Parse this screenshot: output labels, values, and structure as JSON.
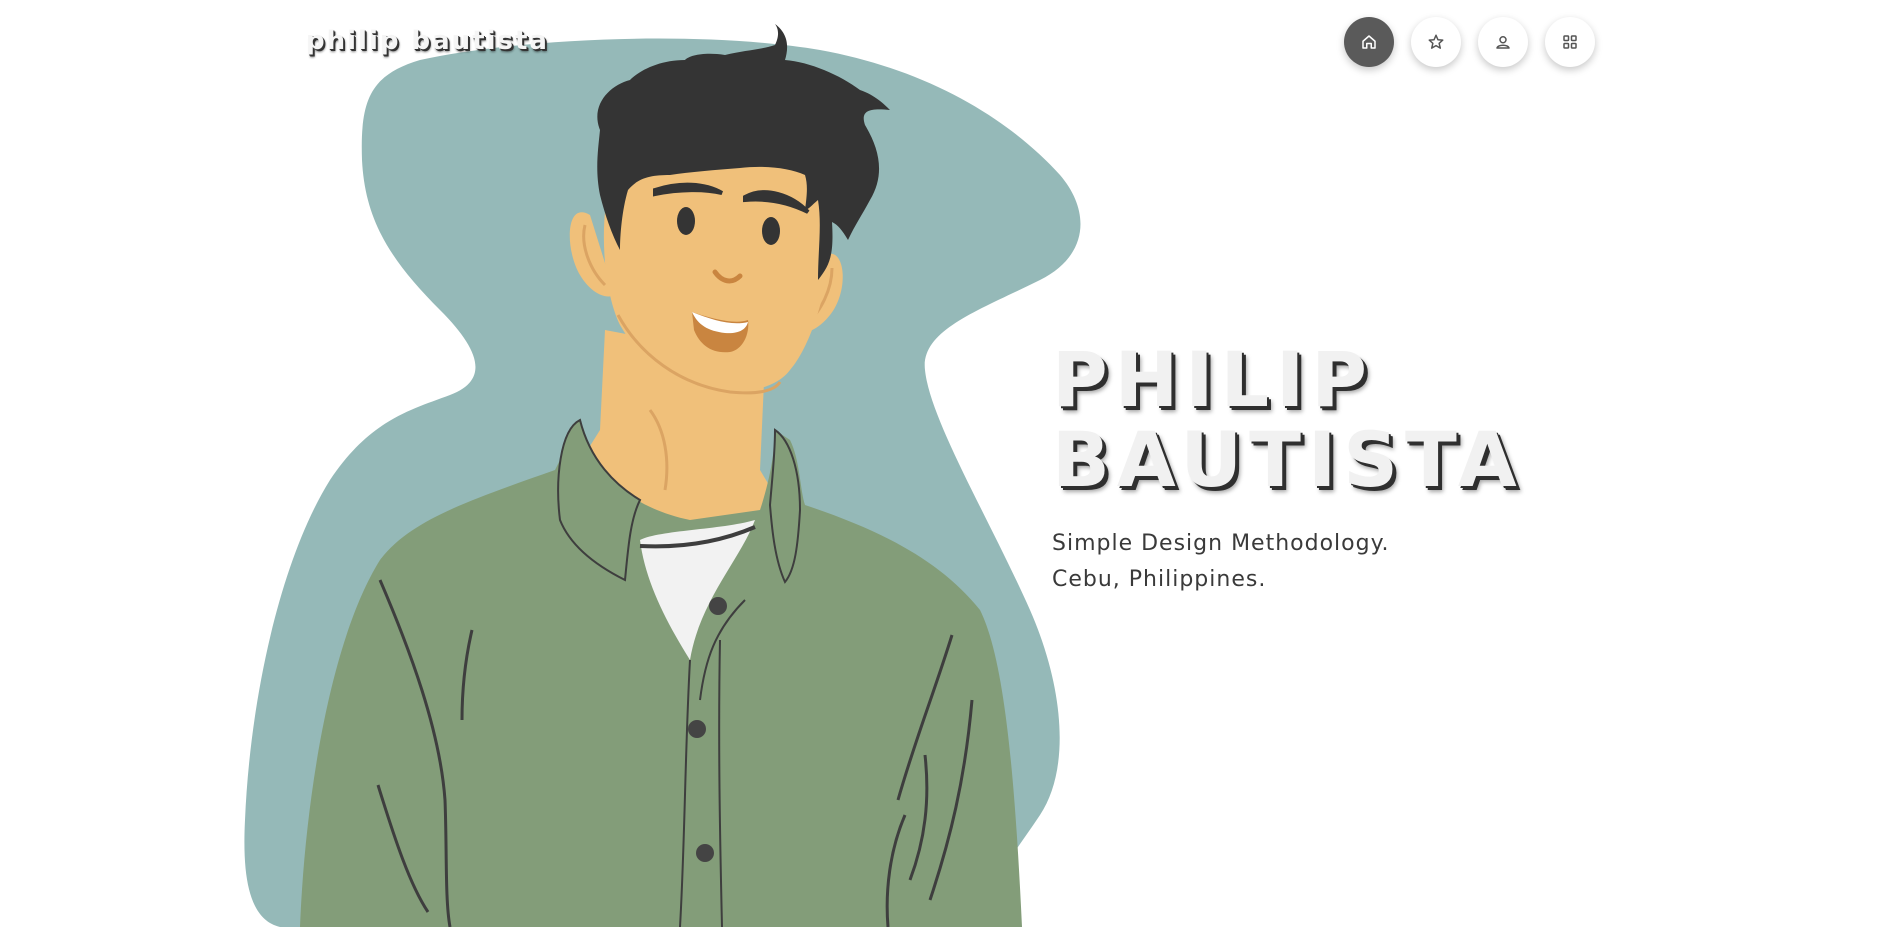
{
  "brand": {
    "logo_text": "philip bautista"
  },
  "nav": {
    "items": [
      {
        "icon": "home-icon",
        "active": true
      },
      {
        "icon": "star-icon",
        "active": false
      },
      {
        "icon": "user-icon",
        "active": false
      },
      {
        "icon": "grid-icon",
        "active": false
      }
    ]
  },
  "hero": {
    "title_line1": "PHILIP",
    "title_line2": "BAUTISTA",
    "tagline_line1": "Simple Design Methodology.",
    "tagline_line2": "Cebu, Philippines."
  },
  "colors": {
    "background": "#ffffff",
    "blob": "#95b9b8",
    "shirt": "#839d79",
    "skin": "#f0c07a",
    "hair": "#343434",
    "nav_active": "#5a5a5a"
  }
}
